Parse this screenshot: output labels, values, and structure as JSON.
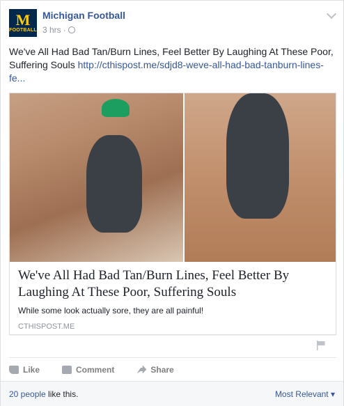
{
  "header": {
    "page_name": "Michigan Football",
    "avatar_letter": "M",
    "avatar_text": "FOOTBALL",
    "time": "3 hrs",
    "separator": "·"
  },
  "post": {
    "text": "We've All Had Bad Tan/Burn Lines, Feel Better By Laughing At These Poor, Suffering Souls ",
    "link": "http://cthispost.me/sdjd8-weve-all-had-bad-tanburn-lines-fe..."
  },
  "card": {
    "title": "We've All Had Bad Tan/Burn Lines, Feel Better By Laughing At These Poor, Suffering Souls",
    "description": "While some look actually sore, they are all painful!",
    "domain": "CTHISPOST.ME"
  },
  "actions": {
    "like": "Like",
    "comment": "Comment",
    "share": "Share"
  },
  "footer": {
    "likes_count": "20 people",
    "likes_suffix": " like this.",
    "sort": "Most Relevant ▾"
  },
  "colors": {
    "link": "#365899",
    "meta": "#90949c",
    "avatar_bg": "#00274c",
    "avatar_fg": "#ffcb05"
  }
}
